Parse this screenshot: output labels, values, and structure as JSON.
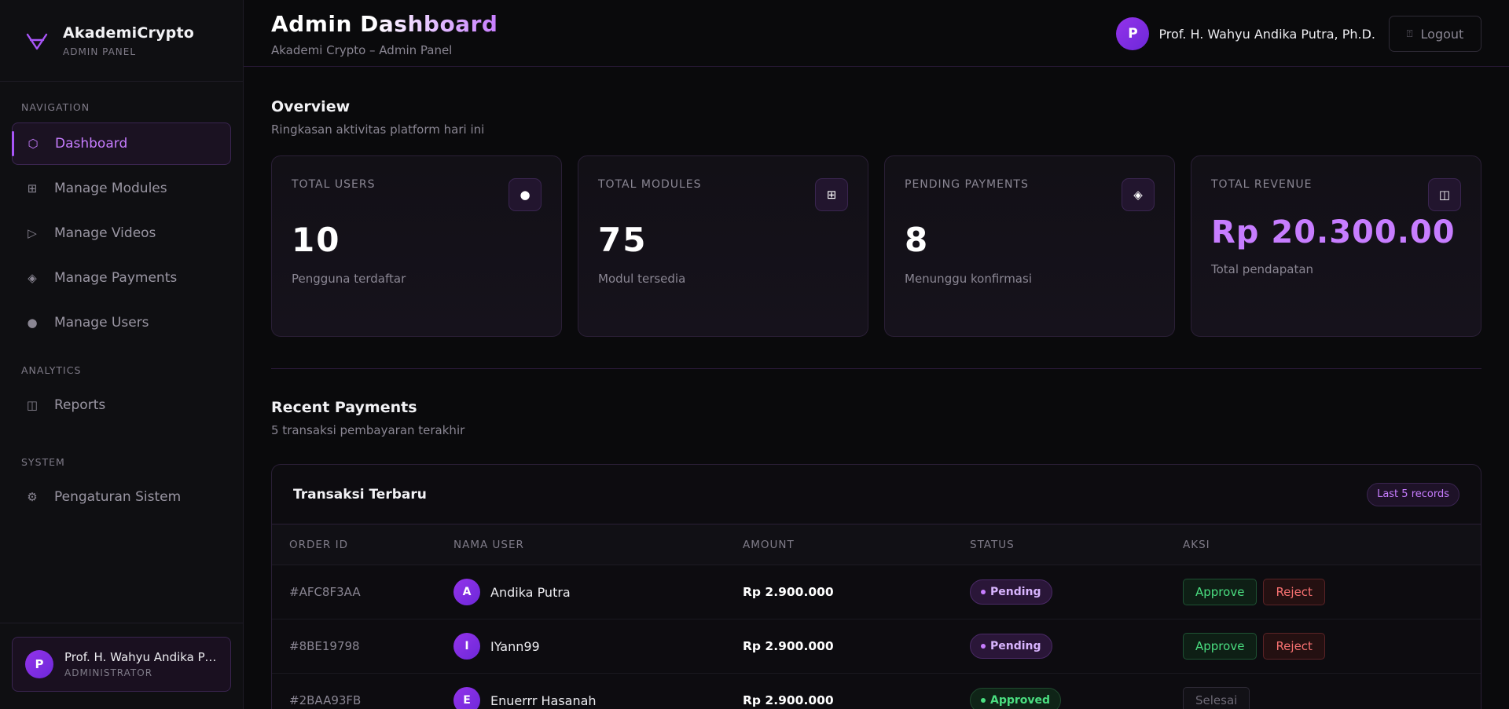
{
  "brand": {
    "name": "AkademiCrypto",
    "sub": "ADMIN PANEL"
  },
  "nav": {
    "section_navigation": "NAVIGATION",
    "section_analytics": "ANALYTICS",
    "section_system": "SYSTEM",
    "items": [
      {
        "label": "Dashboard",
        "icon": "⬡"
      },
      {
        "label": "Manage Modules",
        "icon": "⊞"
      },
      {
        "label": "Manage Videos",
        "icon": "▷"
      },
      {
        "label": "Manage Payments",
        "icon": "◈"
      },
      {
        "label": "Manage Users",
        "icon": "●"
      }
    ],
    "analytics_items": [
      {
        "label": "Reports",
        "icon": "◫"
      }
    ],
    "system_items": [
      {
        "label": "Pengaturan Sistem",
        "icon": "⚙"
      }
    ]
  },
  "sidebar_user": {
    "initial": "P",
    "name": "Prof. H. Wahyu Andika Pu...",
    "role": "ADMINISTRATOR"
  },
  "header": {
    "title": "Admin Dashboard",
    "subtitle": "Akademi Crypto – Admin Panel",
    "user_initial": "P",
    "user_name": "Prof. H. Wahyu Andika Putra, Ph.D.",
    "logout_label": "Logout",
    "logout_icon": "⍐"
  },
  "overview": {
    "title": "Overview",
    "subtitle": "Ringkasan aktivitas platform hari ini",
    "cards": [
      {
        "label": "TOTAL USERS",
        "icon": "●",
        "value": "10",
        "note": "Pengguna terdaftar"
      },
      {
        "label": "TOTAL MODULES",
        "icon": "⊞",
        "value": "75",
        "note": "Modul tersedia"
      },
      {
        "label": "PENDING PAYMENTS",
        "icon": "◈",
        "value": "8",
        "note": "Menunggu konfirmasi"
      },
      {
        "label": "TOTAL REVENUE",
        "icon": "◫",
        "value": "Rp 20.300.00",
        "note": "Total pendapatan"
      }
    ]
  },
  "recent": {
    "title": "Recent Payments",
    "subtitle": "5 transaksi pembayaran terakhir",
    "table_title": "Transaksi Terbaru",
    "badge": "Last 5 records",
    "columns": [
      "ORDER ID",
      "NAMA USER",
      "AMOUNT",
      "STATUS",
      "AKSI"
    ],
    "rows": [
      {
        "order_id": "#AFC8F3AA",
        "initial": "A",
        "name": "Andika Putra",
        "amount": "Rp 2.900.000",
        "status": "Pending",
        "approve": "Approve",
        "reject": "Reject"
      },
      {
        "order_id": "#8BE19798",
        "initial": "I",
        "name": "IYann99",
        "amount": "Rp 2.900.000",
        "status": "Pending",
        "approve": "Approve",
        "reject": "Reject"
      },
      {
        "order_id": "#2BAA93FB",
        "initial": "E",
        "name": "Enuerrr Hasanah",
        "amount": "Rp 2.900.000",
        "status": "Approved",
        "done": "Selesai"
      }
    ]
  },
  "colors": {
    "accent": "#a855f7",
    "accent_light": "#c77dff",
    "success": "#4ade80",
    "danger": "#f87171",
    "background": "#0a0a0c"
  }
}
